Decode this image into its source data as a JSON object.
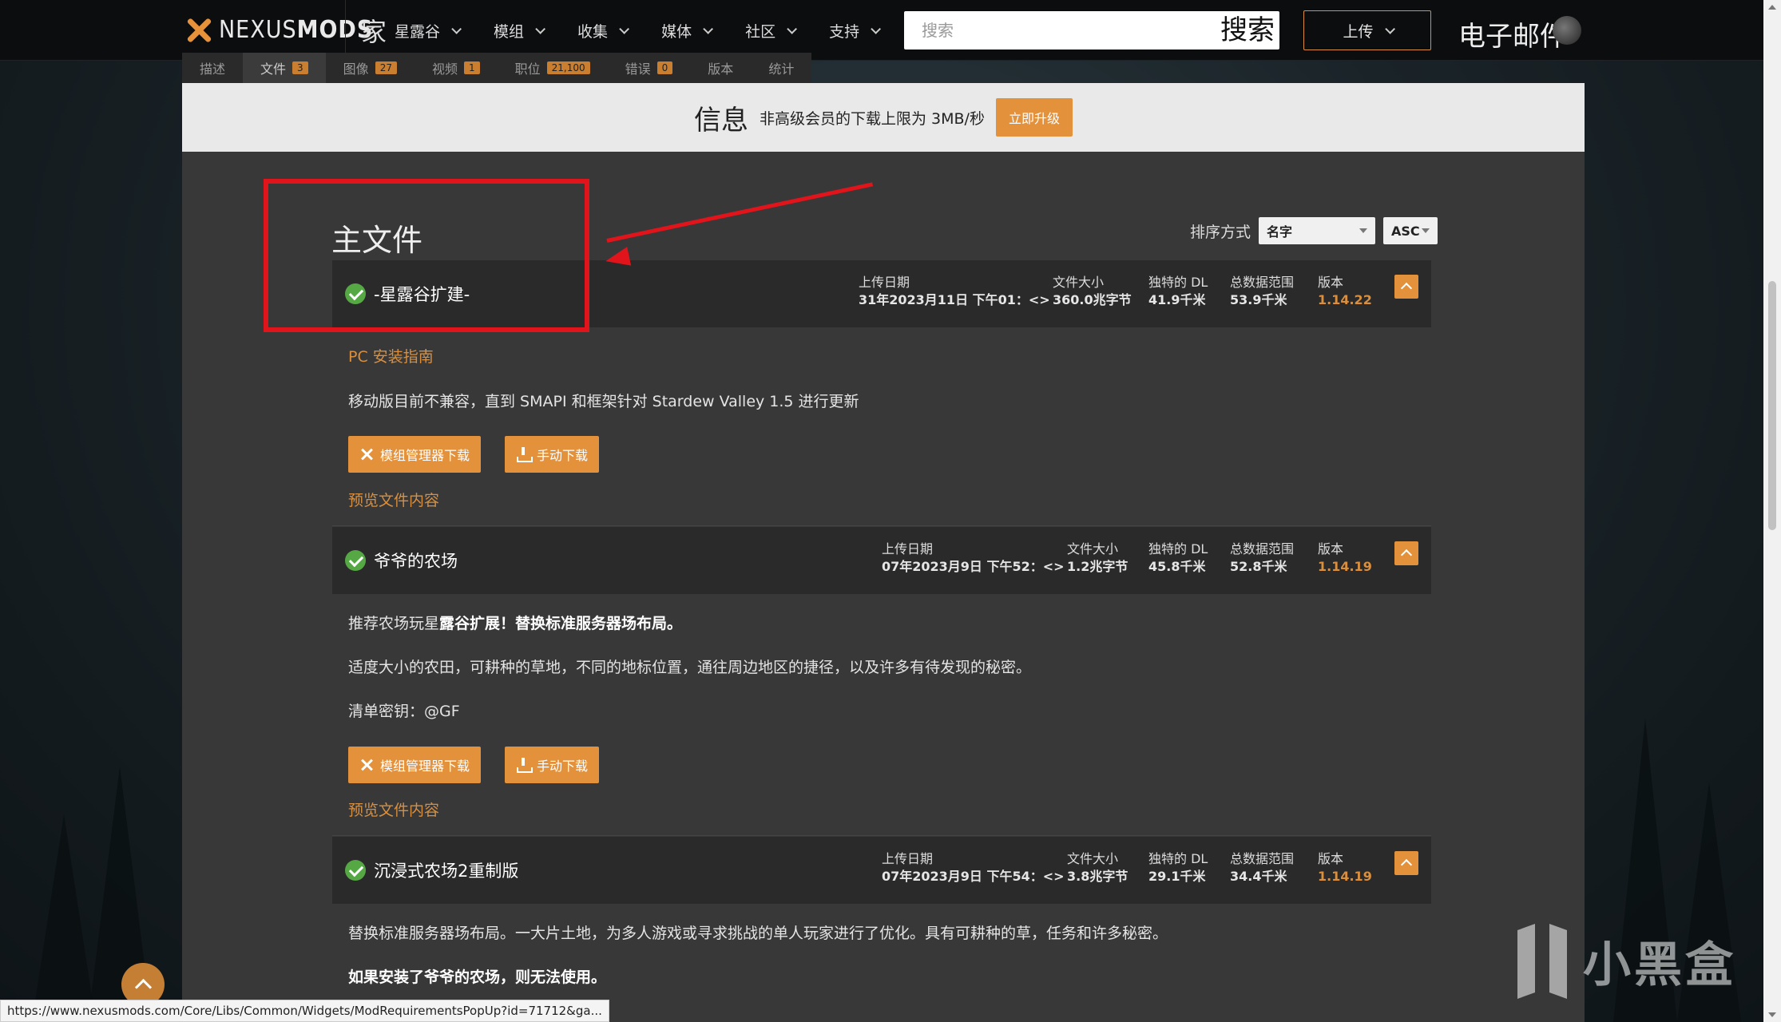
{
  "topbar": {
    "logo_text_light": "NEXUS",
    "logo_text_bold": "MODS",
    "home_label": "家",
    "game_label": "星露谷",
    "nav": [
      {
        "label": "模组"
      },
      {
        "label": "收集"
      },
      {
        "label": "媒体"
      },
      {
        "label": "社区"
      },
      {
        "label": "支持"
      }
    ],
    "search_placeholder": "搜索",
    "search_button": "搜索",
    "upload_label": "上传",
    "mail_label": "电子邮件"
  },
  "tabs": [
    {
      "label": "描述",
      "count": ""
    },
    {
      "label": "文件",
      "count": "3"
    },
    {
      "label": "图像",
      "count": "27"
    },
    {
      "label": "视频",
      "count": "1"
    },
    {
      "label": "职位",
      "count": "21,100"
    },
    {
      "label": "错误",
      "count": "0"
    },
    {
      "label": "版本",
      "count": ""
    },
    {
      "label": "统计",
      "count": ""
    }
  ],
  "banner": {
    "title": "信息",
    "text": "非高级会员的下载上限为 3MB/秒",
    "button": "立即升级"
  },
  "section": {
    "title": "主文件",
    "sort_label": "排序方式",
    "sort_value": "名字",
    "sort_order": "ASC"
  },
  "labels": {
    "upload_date": "上传日期",
    "file_size": "文件大小",
    "unique_dl": "独特的 DL",
    "total_dl": "总数据范围",
    "version": "版本",
    "mod_manager_download": "模组管理器下载",
    "manual_download": "手动下载",
    "preview_contents": "预览文件内容"
  },
  "files": [
    {
      "name": "-星露谷扩建-",
      "upload_date": "31年2023月11日 下午01：<>",
      "size": "360.0兆字节",
      "unique_dl": "41.9千米",
      "total_dl": "53.9千米",
      "version": "1.14.22",
      "install_guide": "PC 安装指南",
      "desc": "移动版目前不兼容，直到 SMAPI 和框架针对 Stardew Valley 1.5 进行更新"
    },
    {
      "name": "爷爷的农场",
      "upload_date": "07年2023月9日 下午52：<>",
      "size": "1.2兆字节",
      "unique_dl": "45.8千米",
      "total_dl": "52.8千米",
      "version": "1.14.19",
      "desc_prefix": "推荐农场玩星",
      "desc_bold": "露谷扩展！替换标准服务器场布局。",
      "desc2": "适度大小的农田，可耕种的草地，不同的地标位置，通往周边地区的捷径，以及许多有待发现的秘密。",
      "desc3": "清单密钥：@GF"
    },
    {
      "name": "沉浸式农场2重制版",
      "upload_date": "07年2023月9日 下午54：<>",
      "size": "3.8兆字节",
      "unique_dl": "29.1千米",
      "total_dl": "34.4千米",
      "version": "1.14.19",
      "desc": "替换标准服务器场布局。一大片土地，为多人游戏或寻求挑战的单人玩家进行了优化。具有可耕种的草，任务和许多秘密。",
      "desc_bold": "如果安装了爷爷的农场，则无法使用。"
    }
  ],
  "status_url": "https://www.nexusmods.com/Core/Libs/Common/Widgets/ModRequirementsPopUp?id=71712&ga...",
  "watermark": "小黑盒",
  "colors": {
    "accent": "#e4913c",
    "version": "#d98f3e",
    "annotation": "#e1141b",
    "check": "#56a845"
  }
}
